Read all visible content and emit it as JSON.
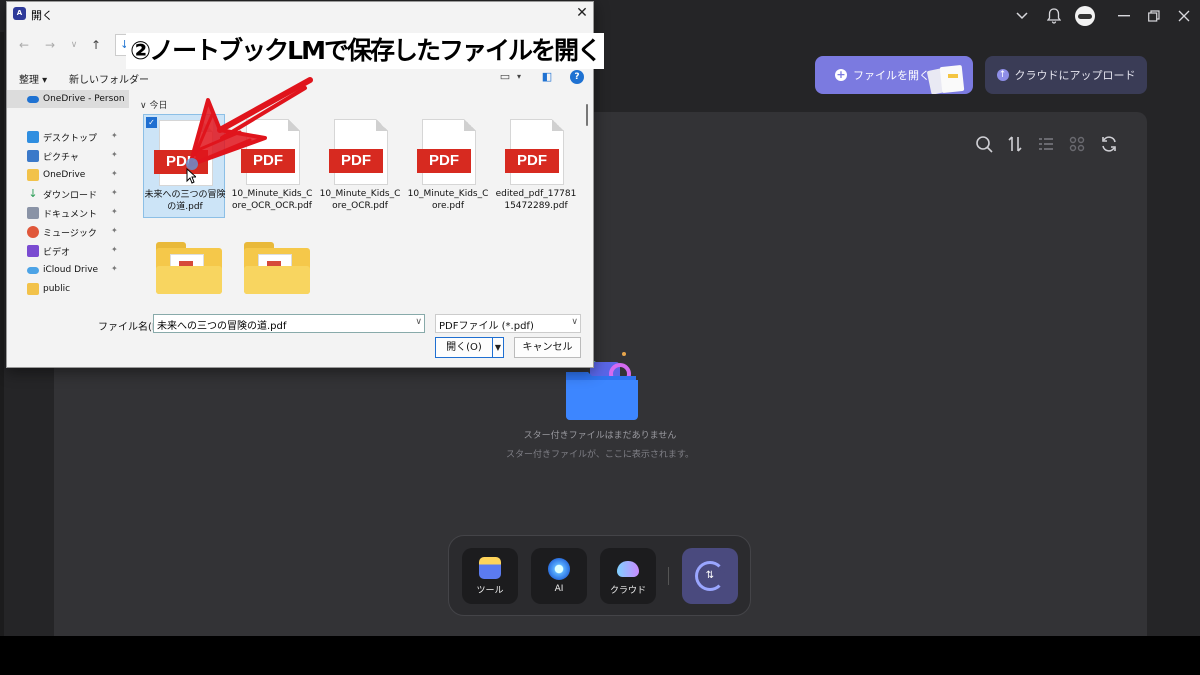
{
  "overlay": {
    "caption": "②ノートブックLMで保存したファイルを開く"
  },
  "app": {
    "open_file_button": "ファイルを開く",
    "cloud_upload_button": "クラウドにアップロード",
    "empty_title": "スター付きファイルはまだありません",
    "empty_subtitle": "スター付きファイルが、ここに表示されます。",
    "dock": {
      "tools": "ツール",
      "ai": "AI",
      "cloud": "クラウド"
    }
  },
  "dialog": {
    "title": "開く",
    "toolbar": {
      "organize": "整理 ▾",
      "new_folder": "新しいフォルダー"
    },
    "sidebar": [
      {
        "label": "OneDrive - Person",
        "icon": "onedrive-icon",
        "color": "#1f72d2"
      },
      {
        "label": "デスクトップ",
        "icon": "desktop-icon",
        "color": "#2f8ee0"
      },
      {
        "label": "ピクチャ",
        "icon": "pictures-icon",
        "color": "#3b79c9"
      },
      {
        "label": "OneDrive",
        "icon": "folder-icon",
        "color": "#f2c24a"
      },
      {
        "label": "ダウンロード",
        "icon": "download-icon",
        "color": "#2a9d56"
      },
      {
        "label": "ドキュメント",
        "icon": "documents-icon",
        "color": "#8a93a6"
      },
      {
        "label": "ミュージック",
        "icon": "music-icon",
        "color": "#e0573a"
      },
      {
        "label": "ビデオ",
        "icon": "video-icon",
        "color": "#7a4bd1"
      },
      {
        "label": "iCloud Drive",
        "icon": "icloud-icon",
        "color": "#4ca3e6"
      },
      {
        "label": "public",
        "icon": "folder-icon",
        "color": "#f2c24a"
      }
    ],
    "group": "今日",
    "files": [
      {
        "name": "未来への三つの冒険の道.pdf",
        "badge": "PDF"
      },
      {
        "name": "10_Minute_Kids_Core_OCR_OCR.pdf",
        "badge": "PDF"
      },
      {
        "name": "10_Minute_Kids_Core_OCR.pdf",
        "badge": "PDF"
      },
      {
        "name": "10_Minute_Kids_Core.pdf",
        "badge": "PDF"
      },
      {
        "name": "edited_pdf_1778115472289.pdf",
        "badge": "PDF"
      }
    ],
    "filename_label": "ファイル名(N):",
    "filename_value": "未来への三つの冒険の道.pdf",
    "filetype_value": "PDFファイル (*.pdf)",
    "open_button": "開く(O)",
    "cancel_button": "キャンセル"
  }
}
